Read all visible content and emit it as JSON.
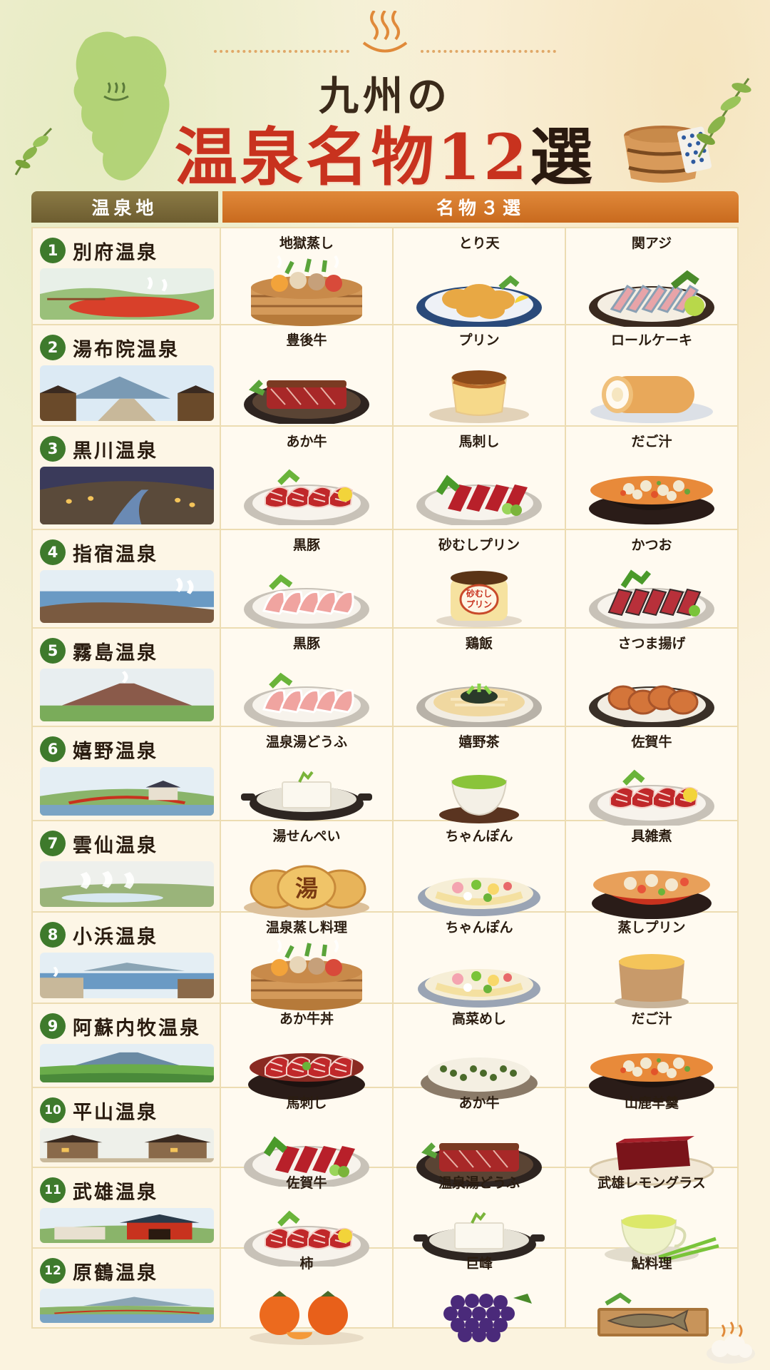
{
  "header": {
    "title_line1": "九州の",
    "title_main": "温泉名物12",
    "title_suffix": "選"
  },
  "table": {
    "col_spot": "温泉地",
    "col_foods": "名物３選"
  },
  "colors": {
    "accent_red": "#c8321e",
    "badge_green": "#3e7a2c",
    "header_orange": "#d47a2c",
    "header_olive": "#7b6b3a"
  },
  "rows": [
    {
      "num": "1",
      "name": "別府温泉",
      "scene": "red-pond",
      "foods": [
        {
          "name": "地獄蒸し",
          "icon": "steamer-basket-icon"
        },
        {
          "name": "とり天",
          "icon": "fried-chicken-icon"
        },
        {
          "name": "関アジ",
          "icon": "sashimi-icon"
        }
      ]
    },
    {
      "num": "2",
      "name": "湯布院温泉",
      "scene": "mountain-town",
      "foods": [
        {
          "name": "豊後牛",
          "icon": "beef-steak-icon"
        },
        {
          "name": "プリン",
          "icon": "pudding-icon"
        },
        {
          "name": "ロールケーキ",
          "icon": "roll-cake-icon"
        }
      ]
    },
    {
      "num": "3",
      "name": "黒川温泉",
      "scene": "night-river",
      "foods": [
        {
          "name": "あか牛",
          "icon": "beef-plate-icon"
        },
        {
          "name": "馬刺し",
          "icon": "horse-sashimi-icon"
        },
        {
          "name": "だご汁",
          "icon": "dumpling-soup-icon"
        }
      ]
    },
    {
      "num": "4",
      "name": "指宿温泉",
      "scene": "seaside",
      "foods": [
        {
          "name": "黒豚",
          "icon": "pork-slices-icon"
        },
        {
          "name": "砂むしプリン",
          "icon": "jar-pudding-icon"
        },
        {
          "name": "かつお",
          "icon": "bonito-icon"
        }
      ]
    },
    {
      "num": "5",
      "name": "霧島温泉",
      "scene": "volcano",
      "foods": [
        {
          "name": "黒豚",
          "icon": "pork-slices-icon"
        },
        {
          "name": "鶏飯",
          "icon": "chicken-rice-icon"
        },
        {
          "name": "さつま揚げ",
          "icon": "fish-cake-icon"
        }
      ]
    },
    {
      "num": "6",
      "name": "嬉野温泉",
      "scene": "red-bridge",
      "foods": [
        {
          "name": "温泉湯どうふ",
          "icon": "tofu-pot-icon"
        },
        {
          "name": "嬉野茶",
          "icon": "green-tea-icon"
        },
        {
          "name": "佐賀牛",
          "icon": "beef-plate-icon"
        }
      ]
    },
    {
      "num": "7",
      "name": "雲仙温泉",
      "scene": "steam-field",
      "foods": [
        {
          "name": "湯せんぺい",
          "icon": "senbei-icon",
          "stamp": "湯"
        },
        {
          "name": "ちゃんぽん",
          "icon": "champon-icon"
        },
        {
          "name": "具雑煮",
          "icon": "zoni-icon"
        }
      ]
    },
    {
      "num": "8",
      "name": "小浜温泉",
      "scene": "bay-town",
      "foods": [
        {
          "name": "温泉蒸し料理",
          "icon": "steamer-basket-icon"
        },
        {
          "name": "ちゃんぽん",
          "icon": "champon-icon"
        },
        {
          "name": "蒸しプリン",
          "icon": "steamed-pudding-icon"
        }
      ]
    },
    {
      "num": "9",
      "name": "阿蘇内牧温泉",
      "scene": "volcano-green",
      "foods": [
        {
          "name": "あか牛丼",
          "icon": "beef-bowl-icon"
        },
        {
          "name": "高菜めし",
          "icon": "takana-rice-icon"
        },
        {
          "name": "だご汁",
          "icon": "dumpling-soup-icon"
        }
      ]
    },
    {
      "num": "10",
      "name": "平山温泉",
      "scene": "village",
      "foods": [
        {
          "name": "馬刺し",
          "icon": "horse-sashimi-icon"
        },
        {
          "name": "あか牛",
          "icon": "beef-steak-icon"
        },
        {
          "name": "山鹿羊羹",
          "icon": "yokan-icon"
        }
      ]
    },
    {
      "num": "11",
      "name": "武雄温泉",
      "scene": "red-gate",
      "foods": [
        {
          "name": "佐賀牛",
          "icon": "beef-plate-icon"
        },
        {
          "name": "温泉湯どうふ",
          "icon": "tofu-pot-icon"
        },
        {
          "name": "武雄レモングラス",
          "icon": "lemongrass-tea-icon"
        }
      ]
    },
    {
      "num": "12",
      "name": "原鶴温泉",
      "scene": "river-bridge",
      "foods": [
        {
          "name": "柿",
          "icon": "persimmon-icon"
        },
        {
          "name": "巨峰",
          "icon": "grapes-icon"
        },
        {
          "name": "鮎料理",
          "icon": "ayu-fish-icon"
        }
      ]
    }
  ],
  "pudding_label": "砂むし\nプリン"
}
